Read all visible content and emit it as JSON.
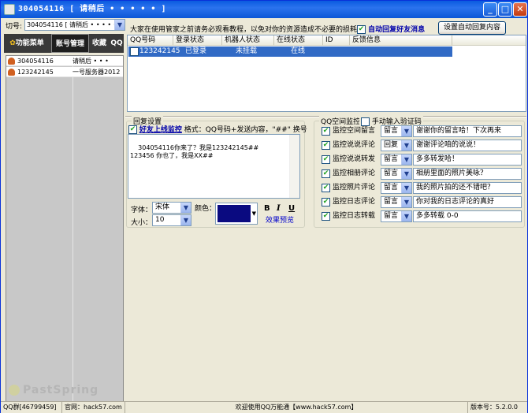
{
  "title": "304054116 [ 请稍后 • • • • • ]",
  "left": {
    "account_label": "切号:",
    "account_value": "304054116 [ 请稍后 • • • • •",
    "tabs": [
      "功能菜单",
      "账号管理",
      "收藏",
      "QQ"
    ],
    "rows": [
      {
        "a": "304054116",
        "b": "请稍后 • • •"
      },
      {
        "a": "123242145",
        "b": "一号服务器2012"
      }
    ],
    "watermark": "PastSpring"
  },
  "top": {
    "notice": "大家在使用管家之前请务必观看教程，以免对你的资源造成不必要的损耗",
    "autoreply_label": "自动回复好友消息",
    "settings_button": "设置自动回复内容"
  },
  "grid": {
    "headers": [
      "QQ号码",
      "登录状态",
      "机器人状态",
      "在线状态",
      "ID",
      "反馈信息"
    ],
    "rows": [
      {
        "qq": "123242145",
        "login": "已登录",
        "robot": "未挂载",
        "online": "在线"
      }
    ]
  },
  "reply": {
    "group_title": "回复设置",
    "monitor_label": "好友上线监控",
    "format_hint": "格式：QQ号码+发送内容，\"##\" 换号",
    "content": "304054116你来了？我是123242145##\n123456 你也了，我是XX##",
    "font_label": "字体：",
    "font_value": "宋体",
    "size_label": "大小：",
    "size_value": "10",
    "color_label": "颜色：",
    "color_value": "#0a0a80",
    "bold": "B",
    "italic": "I",
    "underline": "U",
    "preview_label": "效果预览"
  },
  "monitor": {
    "group_title": "QQ空间监控",
    "captcha_label": "手动输入验证码",
    "items": [
      {
        "label": "监控空间留言",
        "mode": "留言",
        "text": "谢谢你的留言哈！下次再来"
      },
      {
        "label": "监控说说评论",
        "mode": "回复",
        "text": "谢谢评论咱的说说！"
      },
      {
        "label": "监控说说转发",
        "mode": "留言",
        "text": "多多转发哈！"
      },
      {
        "label": "监控相册评论",
        "mode": "留言",
        "text": "相册里面的照片美咏？"
      },
      {
        "label": "监控照片评论",
        "mode": "留言",
        "text": "我的照片拍的还不错吧？"
      },
      {
        "label": "监控日志评论",
        "mode": "留言",
        "text": "你对我的日志评论的真好"
      },
      {
        "label": "监控日志转载",
        "mode": "留言",
        "text": "多多转载 0-0"
      }
    ]
  },
  "status": {
    "group": "QQ群[46799459]",
    "site": "官网：hack57.com",
    "welcome": "欢迎使用QQ万能通【www.hack57.com】",
    "version": "版本号：5.2.0.0"
  }
}
